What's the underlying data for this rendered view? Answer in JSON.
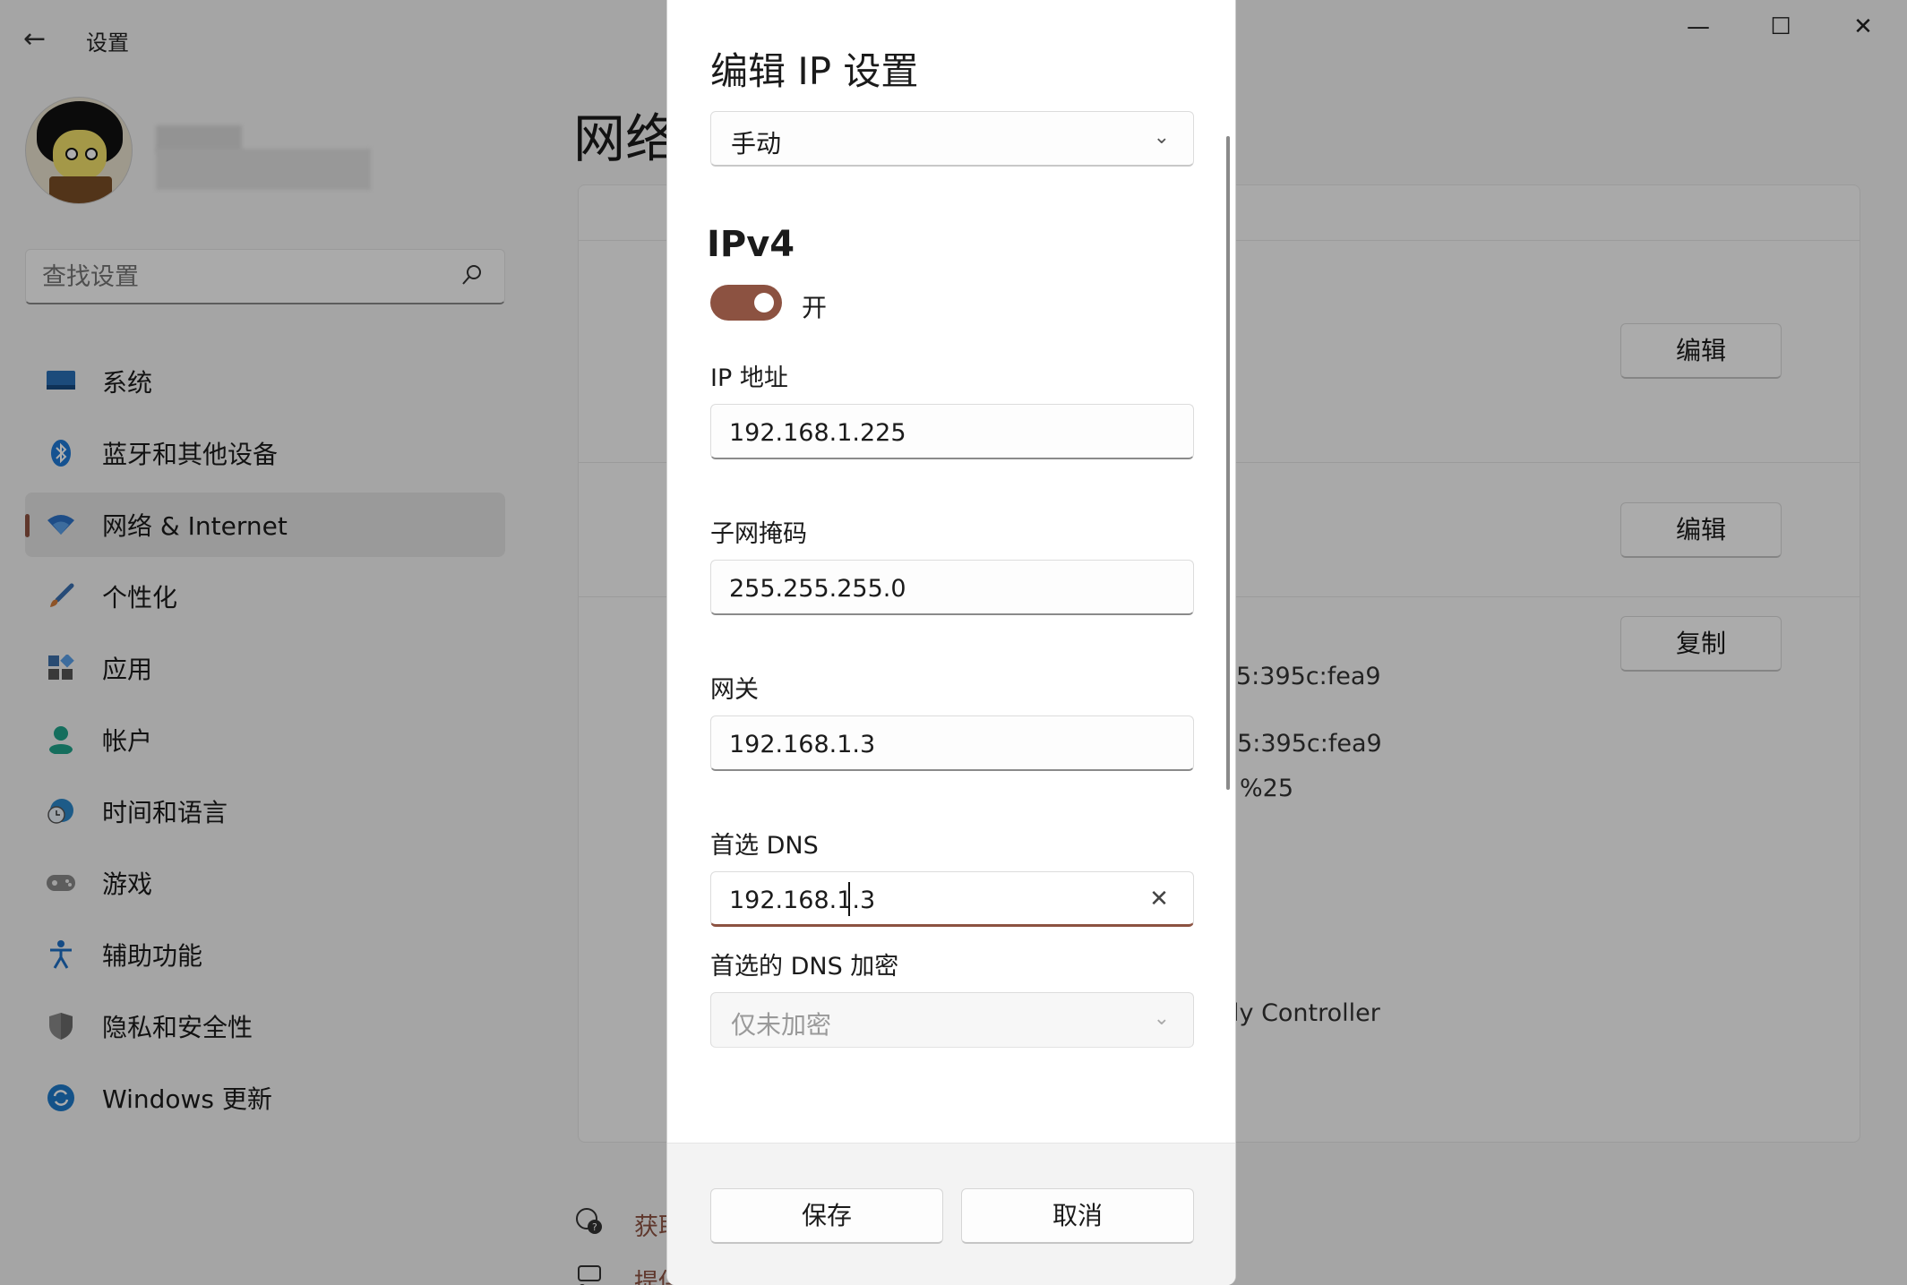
{
  "window": {
    "title": "设置",
    "minimize": "—",
    "maximize": "☐",
    "close": "✕"
  },
  "search": {
    "placeholder": "查找设置"
  },
  "sidebar": {
    "items": [
      {
        "label": "系统",
        "icon": "monitor-icon",
        "color": "#2a6fb5"
      },
      {
        "label": "蓝牙和其他设备",
        "icon": "bluetooth-icon",
        "color": "#1f7ad6"
      },
      {
        "label": "网络 & Internet",
        "icon": "wifi-icon",
        "color": "#2d72c8",
        "active": true
      },
      {
        "label": "个性化",
        "icon": "brush-icon",
        "color": "#d17b3a"
      },
      {
        "label": "应用",
        "icon": "apps-icon",
        "color": "#3d6fa8"
      },
      {
        "label": "帐户",
        "icon": "person-icon",
        "color": "#1fa38a"
      },
      {
        "label": "时间和语言",
        "icon": "clock-globe-icon",
        "color": "#2b87c9"
      },
      {
        "label": "游戏",
        "icon": "gamepad-icon",
        "color": "#777777"
      },
      {
        "label": "辅助功能",
        "icon": "accessibility-icon",
        "color": "#1e6fc4"
      },
      {
        "label": "隐私和安全性",
        "icon": "shield-icon",
        "color": "#6b6b6b"
      },
      {
        "label": "Windows 更新",
        "icon": "update-icon",
        "color": "#1e79c9"
      }
    ]
  },
  "main": {
    "page_title": "网络",
    "buttons": {
      "edit1": "编辑",
      "edit2": "编辑",
      "copy": "复制"
    },
    "texts": {
      "ipv6_1": "5:395c:fea9",
      "ipv6_2": ":5:395c:fea9",
      "ipv6_3": "%25",
      "adapter": "ly Controller"
    },
    "footer": {
      "help": "获取",
      "feedback": "提供"
    }
  },
  "dialog": {
    "title": "编辑 IP 设置",
    "mode": "手动",
    "section": "IPv4",
    "toggle_state": "开",
    "toggle_on": true,
    "ip_label": "IP 地址",
    "ip_value": "192.168.1.225",
    "mask_label": "子网掩码",
    "mask_value": "255.255.255.0",
    "gateway_label": "网关",
    "gateway_value": "192.168.1.3",
    "dns_label": "首选 DNS",
    "dns_value": "192.168.1.3",
    "dns_enc_label": "首选的 DNS 加密",
    "dns_enc_value": "仅未加密",
    "save": "保存",
    "cancel": "取消"
  },
  "colors": {
    "accent": "#8c5241"
  }
}
